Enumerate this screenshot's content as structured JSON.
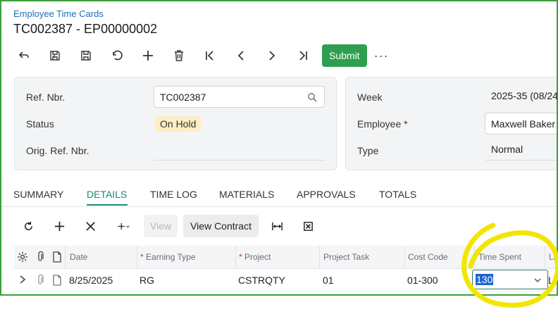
{
  "header": {
    "breadcrumb": "Employee Time Cards",
    "title": "TC002387 - EP00000002"
  },
  "toolbar": {
    "icons": [
      "back-icon",
      "save-close-icon",
      "save-icon",
      "undo-icon",
      "add-icon",
      "delete-icon",
      "first-record-icon",
      "previous-icon",
      "next-icon",
      "last-record-icon"
    ],
    "submit_label": "Submit",
    "more_label": "···",
    "submit_color": "#2e9e4f"
  },
  "summary_left": {
    "ref_nbr_label": "Ref. Nbr.",
    "ref_nbr_value": "TC002387",
    "status_label": "Status",
    "status_value": "On Hold",
    "orig_ref_label": "Orig. Ref. Nbr.",
    "orig_ref_value": ""
  },
  "summary_right": {
    "week_label": "Week",
    "week_value": "2025-35 (08/24",
    "employee_label": "Employee",
    "employee_required": "*",
    "employee_value": "Maxwell Baker",
    "type_label": "Type",
    "type_value": "Normal"
  },
  "tabs": [
    {
      "label": "SUMMARY",
      "active": false
    },
    {
      "label": "DETAILS",
      "active": true
    },
    {
      "label": "TIME LOG",
      "active": false
    },
    {
      "label": "MATERIALS",
      "active": false
    },
    {
      "label": "APPROVALS",
      "active": false
    },
    {
      "label": "TOTALS",
      "active": false
    }
  ],
  "grid_toolbar": {
    "icons": [
      "refresh-icon",
      "add-row-icon",
      "delete-row-icon",
      "add-menu-icon",
      "fit-columns-icon",
      "export-excel-icon"
    ],
    "view_label": "View",
    "view_contract_label": "View Contract"
  },
  "grid": {
    "required_mark": "*",
    "columns": [
      "Date",
      "Earning Type",
      "Project",
      "Project Task",
      "Cost Code",
      "Time Spent",
      "La"
    ],
    "rows": [
      {
        "date": "8/25/2025",
        "earning_type": "RG",
        "project": "CSTRQTY",
        "project_task": "01",
        "cost_code": "01-300",
        "time_spent": "130",
        "last": "LA"
      }
    ]
  },
  "colors": {
    "accent": "#1a8a6e",
    "frame_border": "#3aa13a",
    "annotation": "#f2e600",
    "status_badge": "#fdeec4"
  }
}
